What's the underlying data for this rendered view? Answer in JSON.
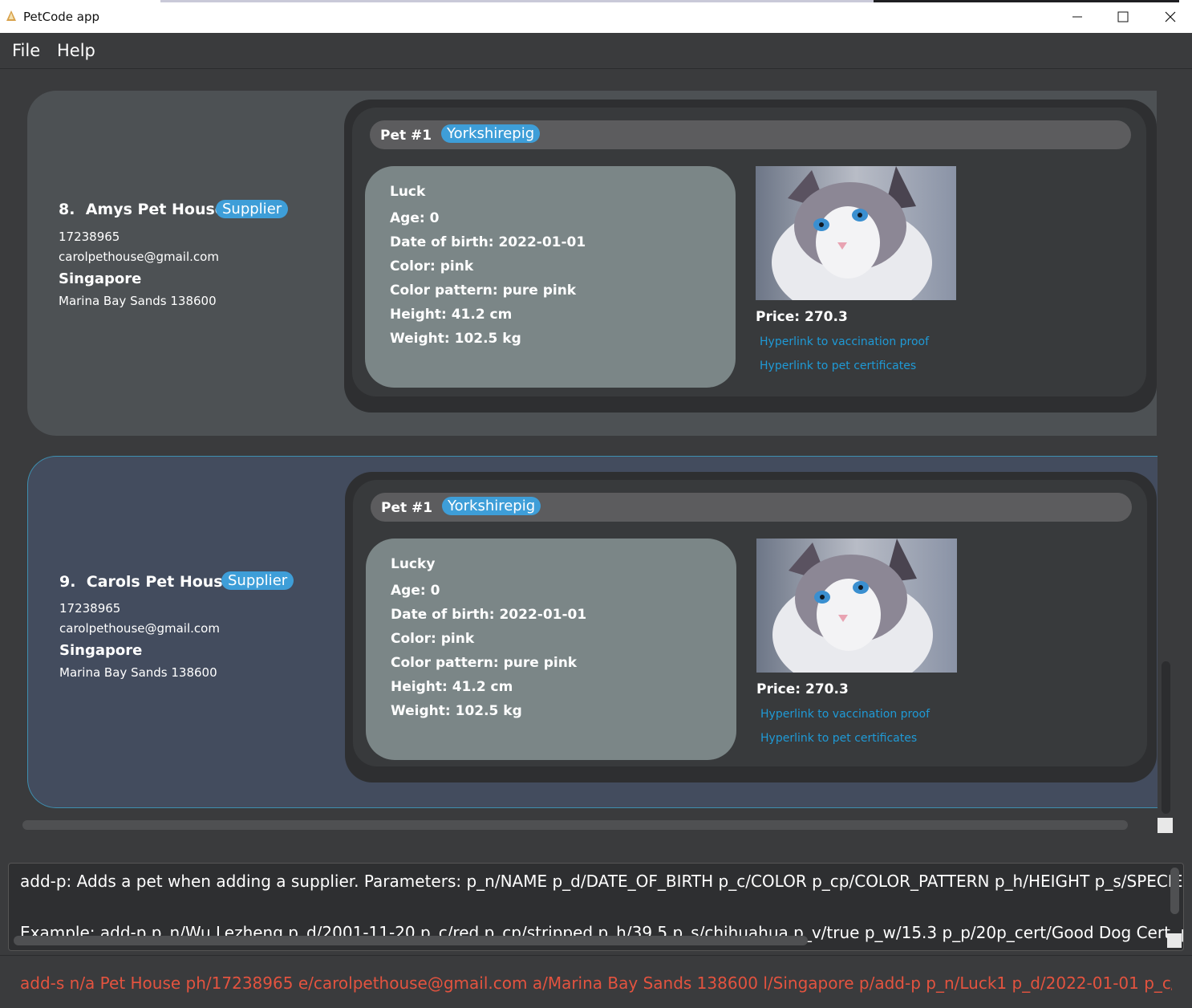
{
  "window": {
    "title": "PetCode app"
  },
  "menu": {
    "file": "File",
    "help": "Help"
  },
  "suppliers": [
    {
      "index": "8.",
      "name": "Amys Pet House",
      "tag": "Supplier",
      "phone": "17238965",
      "email": "carolpethouse@gmail.com",
      "location": "Singapore",
      "address": "Marina Bay Sands 138600",
      "pet": {
        "number": "Pet #1",
        "species": "Yorkshirepig",
        "name": "Luck",
        "age": "Age: 0",
        "dob": "Date of birth: 2022-01-01",
        "color": "Color: pink",
        "pattern": "Color pattern: pure pink",
        "height": "Height: 41.2 cm",
        "weight": "Weight: 102.5 kg",
        "price": "Price: 270.3",
        "vaccination_link": "Hyperlink to vaccination proof",
        "certificates_link": "Hyperlink to pet certificates"
      }
    },
    {
      "index": "9.",
      "name": "Carols Pet House",
      "tag": "Supplier",
      "phone": "17238965",
      "email": "carolpethouse@gmail.com",
      "location": "Singapore",
      "address": "Marina Bay Sands 138600",
      "pet": {
        "number": "Pet #1",
        "species": "Yorkshirepig",
        "name": "Lucky",
        "age": "Age: 0",
        "dob": "Date of birth: 2022-01-01",
        "color": "Color: pink",
        "pattern": "Color pattern: pure pink",
        "height": "Height: 41.2 cm",
        "weight": "Weight: 102.5 kg",
        "price": "Price: 270.3",
        "vaccination_link": "Hyperlink to vaccination proof",
        "certificates_link": "Hyperlink to pet certificates"
      }
    }
  ],
  "result": {
    "line1": "add-p: Adds a pet when adding a supplier. Parameters: p_n/NAME p_d/DATE_OF_BIRTH p_c/COLOR p_cp/COLOR_PATTERN p_h/HEIGHT p_s/SPECIES p_v/VA",
    "line2": "Example: add-p p_n/Wu Lezheng p_d/2001-11-20 p_c/red p_cp/stripped p_h/39.5 p_s/chihuahua p_v/true p_w/15.3 p_p/20p_cert/Good Dog Cert. p_cert/Roya"
  },
  "command": {
    "value": "add-s n/a Pet House ph/17238965 e/carolpethouse@gmail.com a/Marina Bay Sands 138600 l/Singapore p/add-p p_n/Luck1 p_d/2022-01-01 p_c/pink p_cp/pure"
  },
  "colors": {
    "accent": "#3e9ed8",
    "link": "#1f9ad6",
    "command_text": "#e3533f"
  },
  "icons": [
    "app-icon",
    "minimize-icon",
    "maximize-icon",
    "close-icon",
    "cat-photo"
  ]
}
